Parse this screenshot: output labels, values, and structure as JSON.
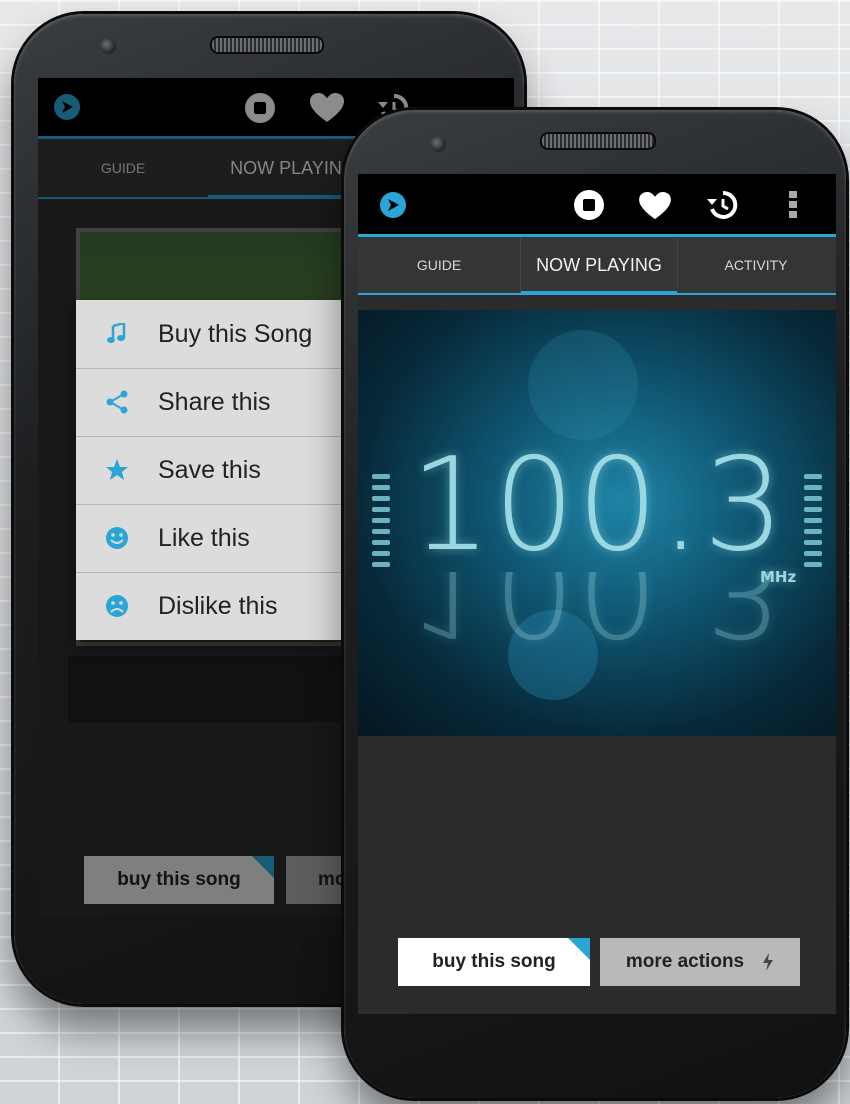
{
  "colors": {
    "accent": "#2aa6d6",
    "bar_bg": "#000000",
    "tab_bg": "#353535"
  },
  "back_phone": {
    "tabs": [
      {
        "label": "GUIDE"
      },
      {
        "label": "NOW PLAYING"
      }
    ],
    "menu": [
      {
        "label": "Buy this Song",
        "icon": "music-note-icon"
      },
      {
        "label": "Share this",
        "icon": "share-icon"
      },
      {
        "label": "Save this",
        "icon": "star-icon"
      },
      {
        "label": "Like this",
        "icon": "smile-icon"
      },
      {
        "label": "Dislike this",
        "icon": "frown-icon"
      }
    ],
    "buy_label": "buy this song",
    "more_label": "mo"
  },
  "front_phone": {
    "toolbar_icons": [
      "app-logo-icon",
      "stop-icon",
      "heart-icon",
      "history-icon",
      "overflow-menu-icon"
    ],
    "tabs": [
      {
        "label": "GUIDE"
      },
      {
        "label": "NOW PLAYING"
      },
      {
        "label": "ACTIVITY"
      }
    ],
    "active_tab": "NOW PLAYING",
    "station": {
      "frequency": "100.3",
      "unit": "MHz"
    },
    "buy_label": "buy this song",
    "more_label": "more actions"
  }
}
